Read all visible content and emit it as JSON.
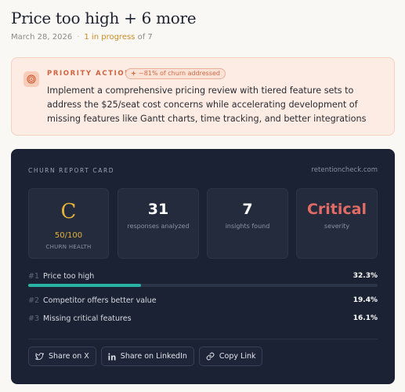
{
  "header": {
    "title": "Price too high + 6 more",
    "date": "March 28, 2026",
    "separator": "·",
    "progress": "1 in progress",
    "progress_suffix": "of 7"
  },
  "priority": {
    "label": "PRIORITY ACTION",
    "badge": "~81% of churn addressed",
    "text": "Implement a comprehensive pricing review with tiered feature sets to address the $25/seat cost concerns while accelerating development of missing features like Gantt charts, time tracking, and better integrations",
    "icon": "target-icon"
  },
  "card": {
    "label": "CHURN REPORT CARD",
    "domain": "retentioncheck.com",
    "grade": {
      "letter": "C",
      "score": "50/100",
      "caption": "CHURN HEALTH"
    },
    "stats": [
      {
        "value": "31",
        "caption": "responses analyzed"
      },
      {
        "value": "7",
        "caption": "insights found"
      },
      {
        "value": "Critical",
        "caption": "severity"
      }
    ],
    "reasons": [
      {
        "num": "#1",
        "label": "Price too high",
        "pct": "32.3%",
        "fill": 0.323
      },
      {
        "num": "#2",
        "label": "Competitor offers better value",
        "pct": "19.4%"
      },
      {
        "num": "#3",
        "label": "Missing critical features",
        "pct": "16.1%"
      }
    ],
    "share": {
      "x": "Share on X",
      "linkedin": "Share on LinkedIn",
      "copy": "Copy Link"
    }
  },
  "colors": {
    "accent_orange": "#d0643e",
    "grade_gold": "#e6b23a",
    "critical_red": "#e36b65",
    "bar_teal": "#2ab3a4",
    "card_bg": "#1b2233"
  }
}
